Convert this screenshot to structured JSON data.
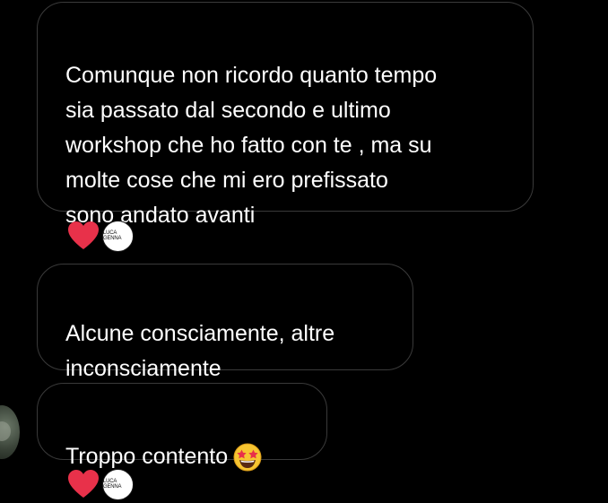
{
  "messages": [
    {
      "text": "Comunque non ricordo quanto tempo\nsia passato dal secondo e ultimo\nworkshop che ho fatto con te , ma su\nmolte cose che mi ero prefissato\nsono andato avanti"
    },
    {
      "text": "Alcune consciamente, altre\ninconsciamente"
    },
    {
      "text": "Troppo contento"
    }
  ],
  "reactions": {
    "emoji_color": "#e8314a",
    "badge_label": "LUCA GENNA"
  },
  "icons": {
    "heart": "heart-reaction-icon",
    "star_struck": "star-struck-emoji-icon"
  }
}
